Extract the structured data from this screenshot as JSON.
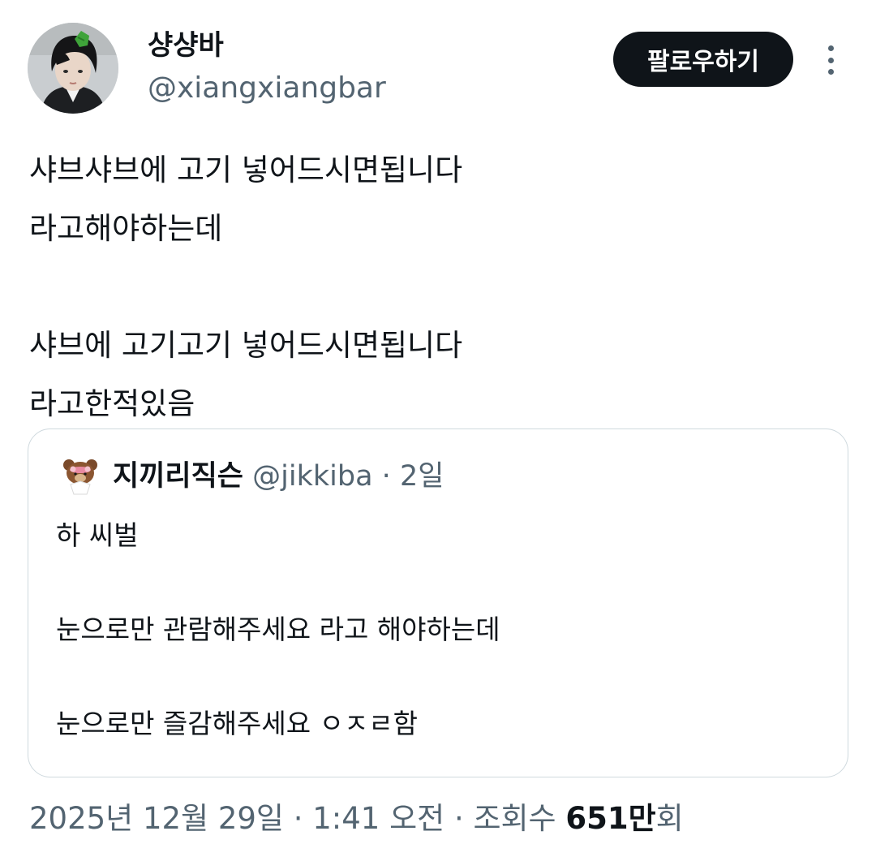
{
  "author": {
    "display_name": "샹샹바",
    "handle": "@xiangxiangbar"
  },
  "follow_button_label": "팔로우하기",
  "more_icon": "more-vertical-icon",
  "tweet_lines": [
    "샤브샤브에 고기 넣어드시면됩니다",
    "라고해야하는데",
    "",
    "샤브에 고기고기 넣어드시면됩니다",
    "라고한적있음"
  ],
  "quote": {
    "display_name": "지끼리직슨",
    "handle": "@jikkiba",
    "separator": "·",
    "time": "2일",
    "lines": [
      "하 씨벌",
      "",
      "눈으로만 관람해주세요 라고 해야하는데",
      "",
      "눈으로만 즐감해주세요 ㅇㅈㄹ함"
    ]
  },
  "meta": {
    "date_time": "2025년 12월 29일 · 1:41 오전 · 조회수 ",
    "views_number": "651만",
    "views_suffix": "회"
  },
  "colors": {
    "text_primary": "#0f1419",
    "text_secondary": "#536471",
    "border": "#cfd9de",
    "button_bg": "#0f1419"
  }
}
